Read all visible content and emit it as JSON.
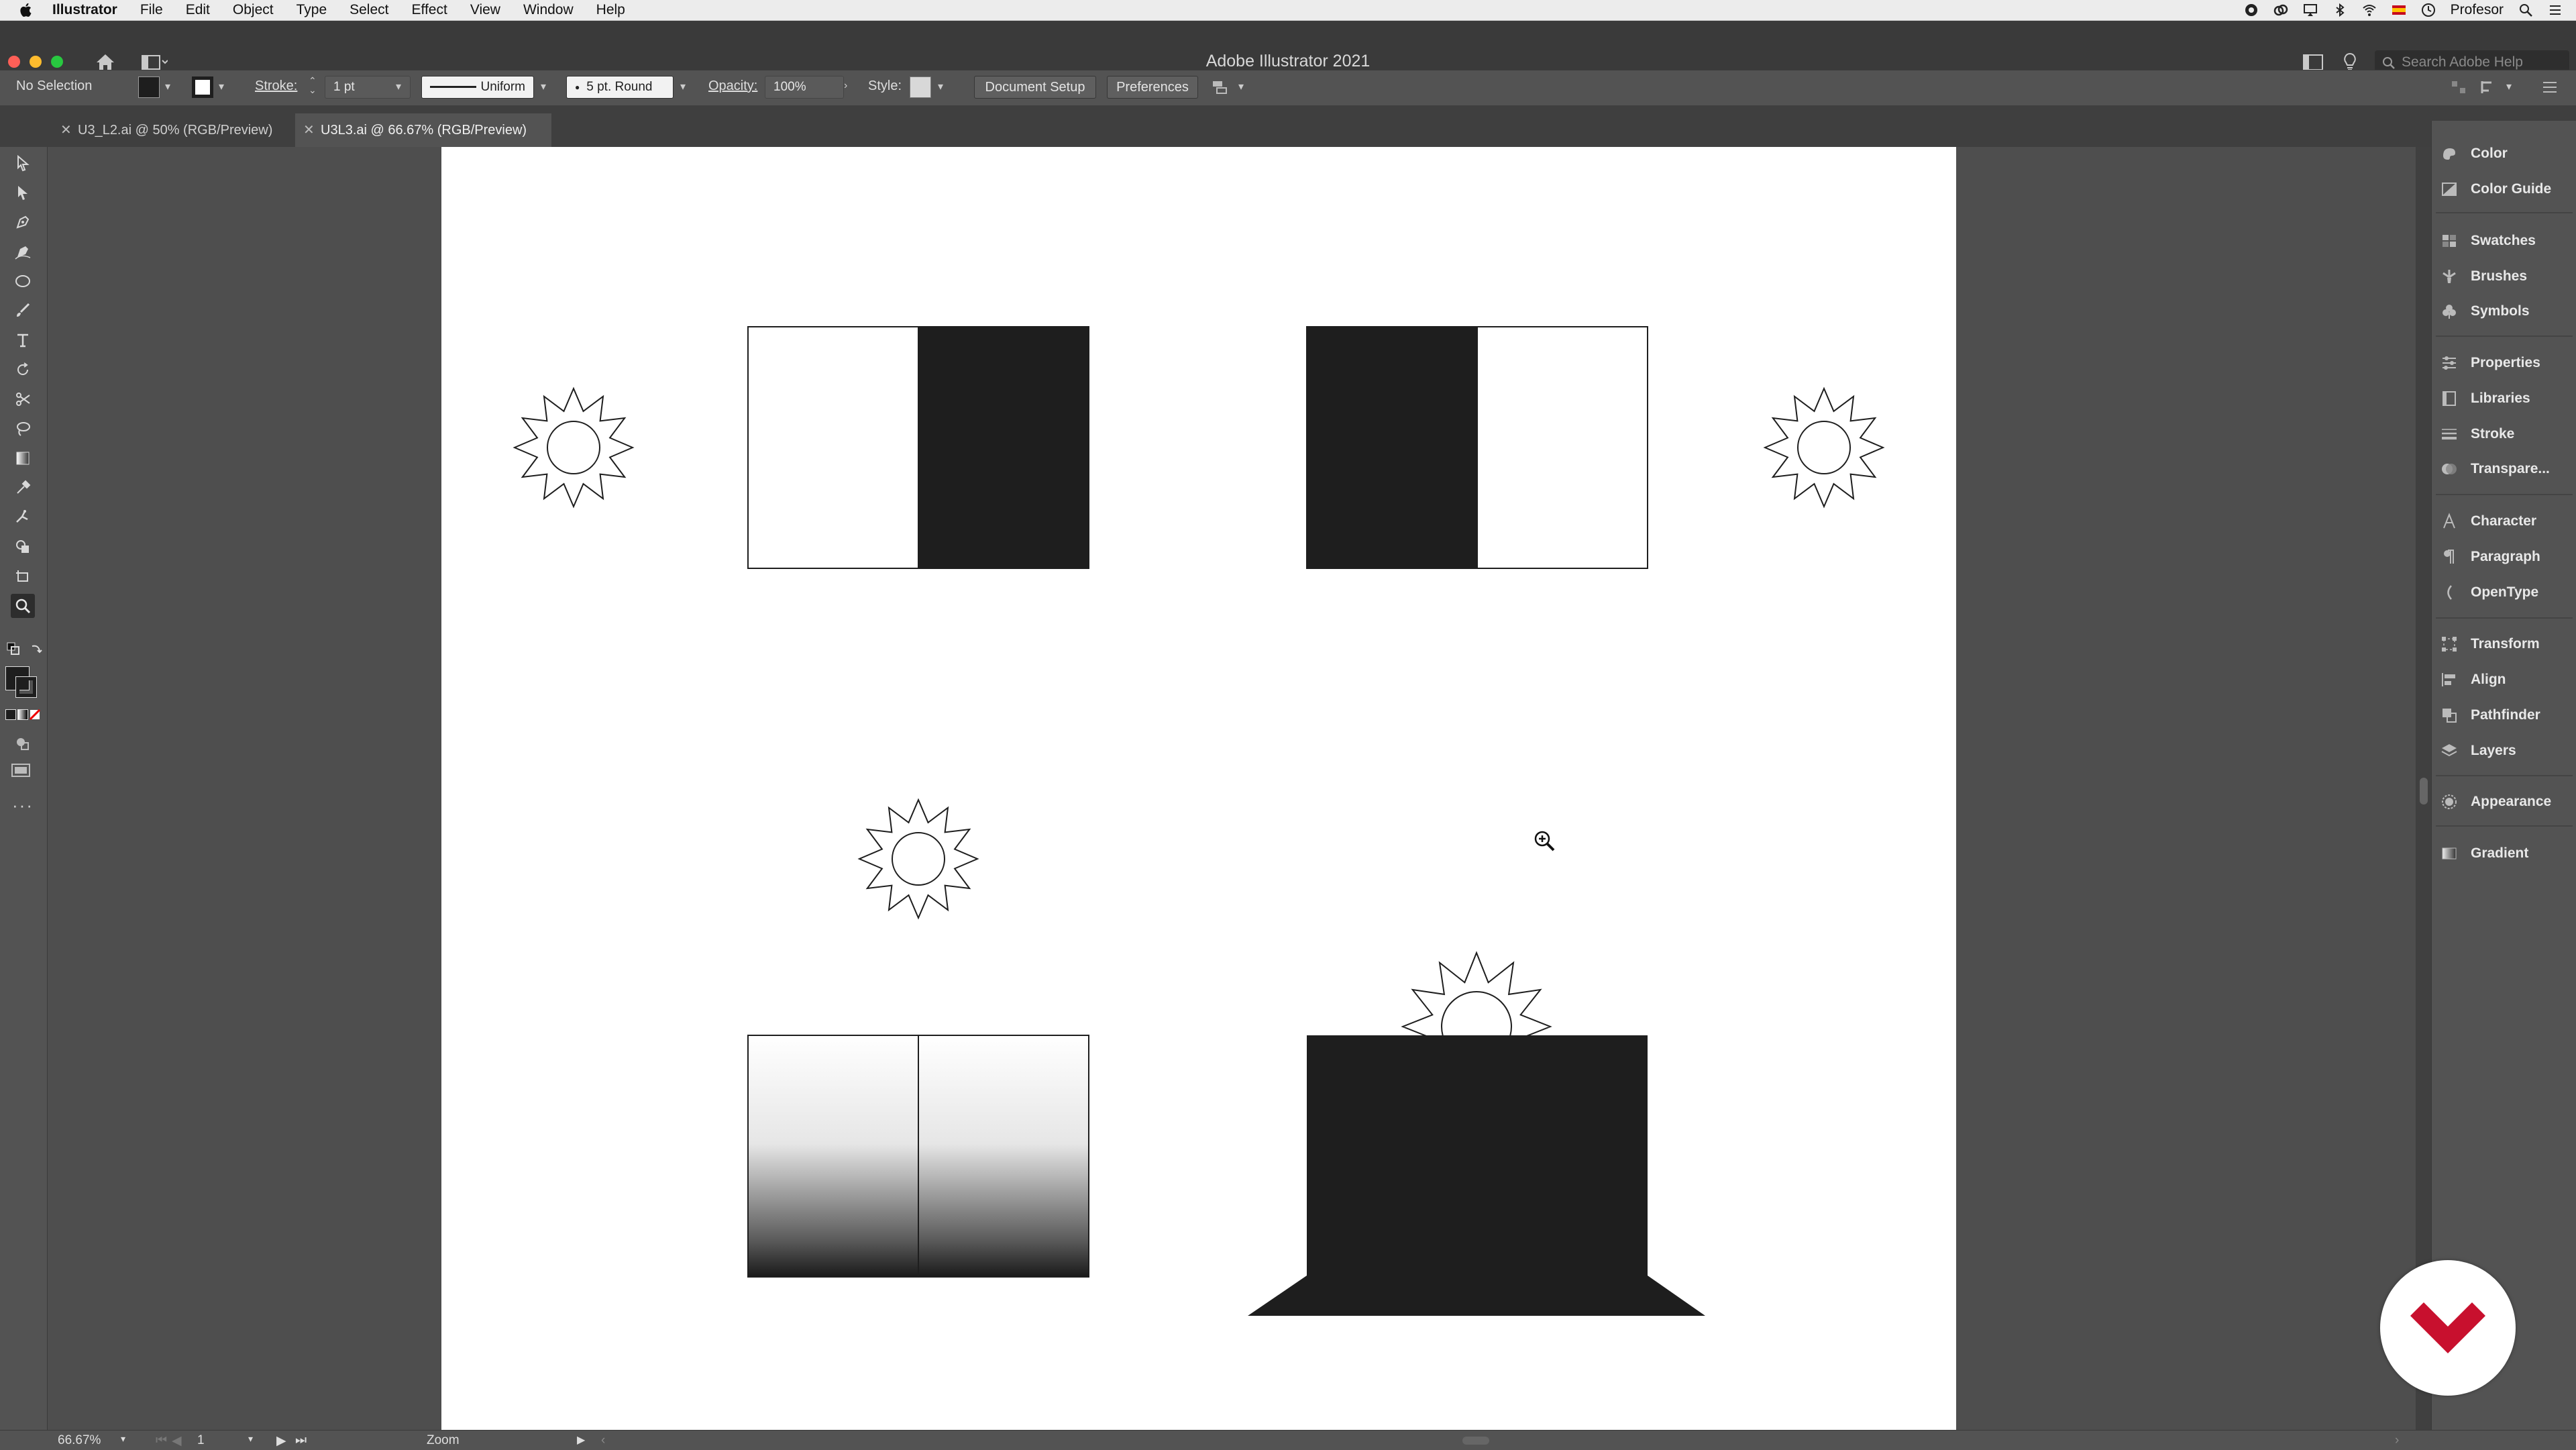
{
  "menubar": {
    "app_name": "Illustrator",
    "items": [
      "File",
      "Edit",
      "Object",
      "Type",
      "Select",
      "Effect",
      "View",
      "Window",
      "Help"
    ],
    "user": "Profesor"
  },
  "window": {
    "title": "Adobe Illustrator 2021",
    "search_placeholder": "Search Adobe Help"
  },
  "control_bar": {
    "selection_status": "No Selection",
    "stroke_label": "Stroke:",
    "stroke_weight": "1 pt",
    "stroke_profile": "Uniform",
    "brush": "5 pt. Round",
    "opacity_label": "Opacity:",
    "opacity_value": "100%",
    "style_label": "Style:",
    "document_setup": "Document Setup",
    "preferences": "Preferences"
  },
  "tabs": [
    {
      "label": "U3_L2.ai @ 50% (RGB/Preview)",
      "active": false
    },
    {
      "label": "U3L3.ai @ 66.67% (RGB/Preview)",
      "active": true
    }
  ],
  "tools": [
    "selection-icon",
    "direct-selection-icon",
    "pen-icon",
    "curvature-icon",
    "ellipse-icon",
    "paintbrush-icon",
    "type-icon",
    "rotate-icon",
    "scissors-icon",
    "lasso-icon",
    "gradient-icon",
    "eyedropper-icon",
    "puppet-warp-icon",
    "shape-builder-icon",
    "artboard-icon",
    "zoom-icon"
  ],
  "panels": [
    {
      "label": "Color",
      "icon": "color-icon"
    },
    {
      "label": "Color Guide",
      "icon": "color-guide-icon"
    },
    {
      "label": "Swatches",
      "icon": "swatches-icon"
    },
    {
      "label": "Brushes",
      "icon": "brushes-icon"
    },
    {
      "label": "Symbols",
      "icon": "symbols-icon"
    },
    {
      "label": "Properties",
      "icon": "properties-icon"
    },
    {
      "label": "Libraries",
      "icon": "libraries-icon"
    },
    {
      "label": "Stroke",
      "icon": "stroke-icon"
    },
    {
      "label": "Transpare...",
      "icon": "transparency-icon"
    },
    {
      "label": "Character",
      "icon": "character-icon"
    },
    {
      "label": "Paragraph",
      "icon": "paragraph-icon"
    },
    {
      "label": "OpenType",
      "icon": "opentype-icon"
    },
    {
      "label": "Transform",
      "icon": "transform-icon"
    },
    {
      "label": "Align",
      "icon": "align-icon"
    },
    {
      "label": "Pathfinder",
      "icon": "pathfinder-icon"
    },
    {
      "label": "Layers",
      "icon": "layers-icon"
    },
    {
      "label": "Appearance",
      "icon": "appearance-icon"
    },
    {
      "label": "Gradient",
      "icon": "gradient-panel-icon"
    }
  ],
  "status_bar": {
    "zoom": "66.67%",
    "artboard_number": "1",
    "tool_name": "Zoom"
  },
  "colors": {
    "accent_logo": "#c8102e",
    "artwork_fill": "#1e1e1e"
  }
}
